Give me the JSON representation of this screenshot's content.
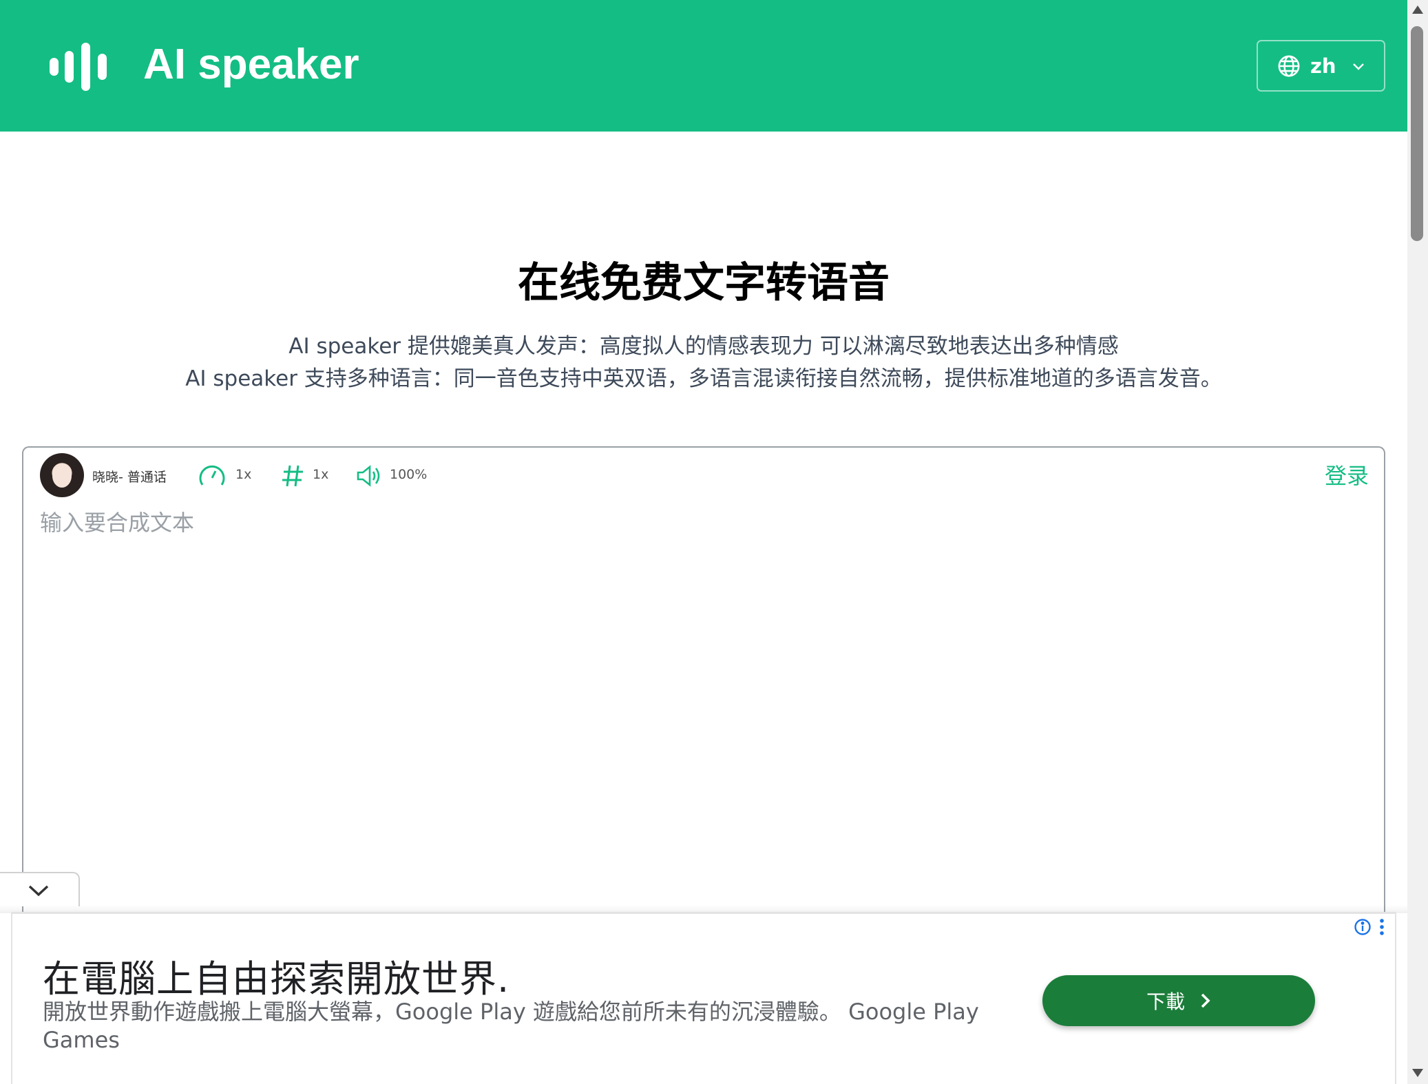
{
  "header": {
    "app_title": "AI speaker",
    "language": "zh",
    "brand_color": "#14bd84"
  },
  "hero": {
    "title": "在线免费文字转语音",
    "subtitle_line1": "AI speaker 提供媲美真人发声：高度拟人的情感表现力 可以淋漓尽致地表达出多种情感",
    "subtitle_line2": "AI speaker 支持多种语言：同一音色支持中英双语，多语言混读衔接自然流畅，提供标准地道的多语言发音。"
  },
  "editor": {
    "voice": "晓晓- 普通话",
    "speed": "1x",
    "pitch": "1x",
    "volume": "100%",
    "login_label": "登录",
    "placeholder": "输入要合成文本",
    "icons": [
      "avatar",
      "speedometer-icon",
      "hash-icon",
      "volume-icon"
    ]
  },
  "ad": {
    "headline": "在電腦上自由探索開放世界.",
    "description": "開放世界動作遊戲搬上電腦大螢幕，Google Play 遊戲給您前所未有的沉浸體驗。 Google Play Games",
    "cta_label": "下載",
    "cta_color": "#1b7d3a",
    "icons": [
      "info-icon",
      "menu-dots-icon",
      "chevron-right-icon"
    ]
  }
}
